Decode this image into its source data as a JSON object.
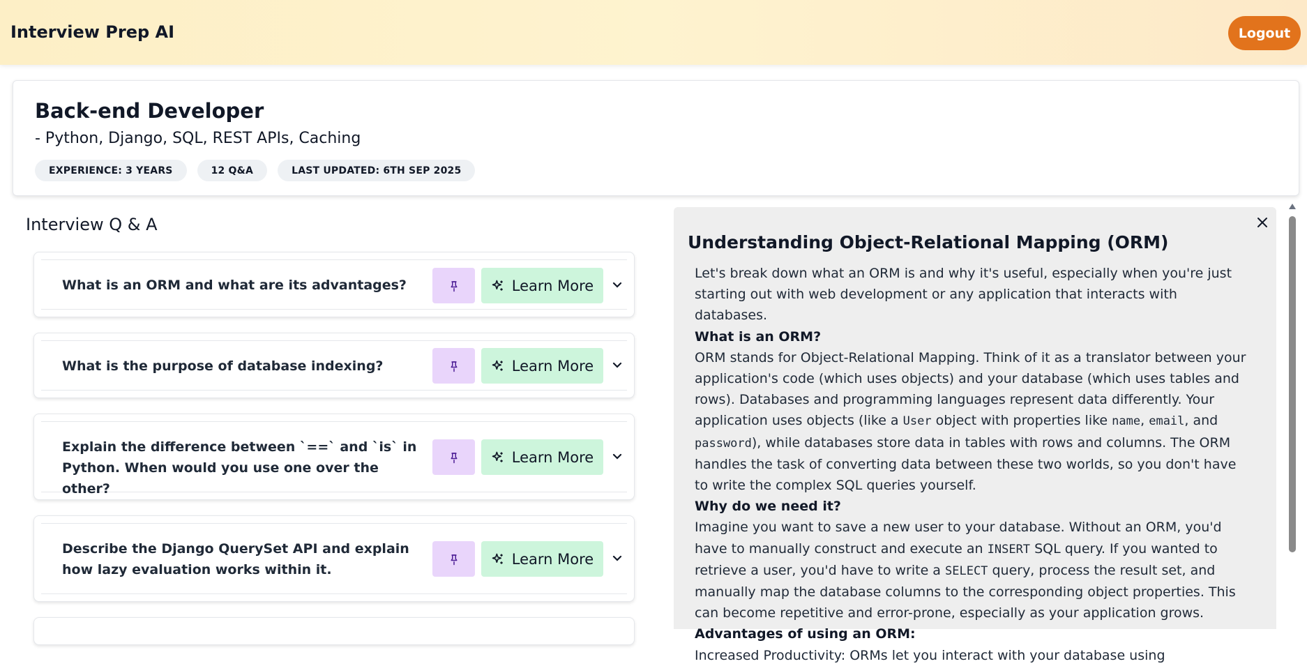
{
  "header": {
    "app_title": "Interview Prep AI",
    "logout_label": "Logout",
    "gradient_colors": [
      "#fdefc6",
      "#fde9c8"
    ],
    "logout_color": "#e2731c"
  },
  "session": {
    "role": "Back-end Developer",
    "topics": "- Python, Django, SQL, REST APIs, Caching",
    "badges": [
      "EXPERIENCE: 3 YEARS",
      "12 Q&A",
      "LAST UPDATED: 6TH SEP 2025"
    ]
  },
  "qa": {
    "heading": "Interview Q & A",
    "learn_more_label": "Learn More",
    "pin_icon": "pin-icon",
    "sparkle_icon": "sparkle-icon",
    "chevron_icon": "chevron-down-icon",
    "questions": [
      "What is an ORM and what are its advantages?",
      "What is the purpose of database indexing?",
      "Explain the difference between `==` and `is` in Python. When would you use one over the other?",
      "Describe the Django QuerySet API and explain how lazy evaluation works within it."
    ]
  },
  "explanation": {
    "title": "Understanding Object-Relational Mapping (ORM)",
    "intro": "Let's break down what an ORM is and why it's useful, especially when you're just starting out with web development or any application that interacts with databases.",
    "h_what": "What is an ORM?",
    "p_what_1": "ORM stands for Object-Relational Mapping. Think of it as a translator between your application's code (which uses objects) and your database (which uses tables and rows). Databases and programming languages represent data differently. Your application uses objects (like a ",
    "code_user": "User",
    "p_what_2": " object with properties like ",
    "code_name": "name",
    "p_what_3": ", ",
    "code_email": "email",
    "p_what_4": ", and ",
    "code_password": "password",
    "p_what_5": "), while databases store data in tables with rows and columns. The ORM handles the task of converting data between these two worlds, so you don't have to write the complex SQL queries yourself.",
    "h_why": "Why do we need it?",
    "p_why_1": "Imagine you want to save a new user to your database. Without an ORM, you'd have to manually construct and execute an ",
    "code_insert": "INSERT",
    "p_why_2": " SQL query. If you wanted to retrieve a user, you'd have to write a ",
    "code_select": "SELECT",
    "p_why_3": " query, process the result set, and manually map the database columns to the corresponding object properties. This can become repetitive and error-prone, especially as your application grows.",
    "h_adv": "Advantages of using an ORM:",
    "p_adv_partial": "Increased Productivity: ORMs let you interact with your database using"
  }
}
